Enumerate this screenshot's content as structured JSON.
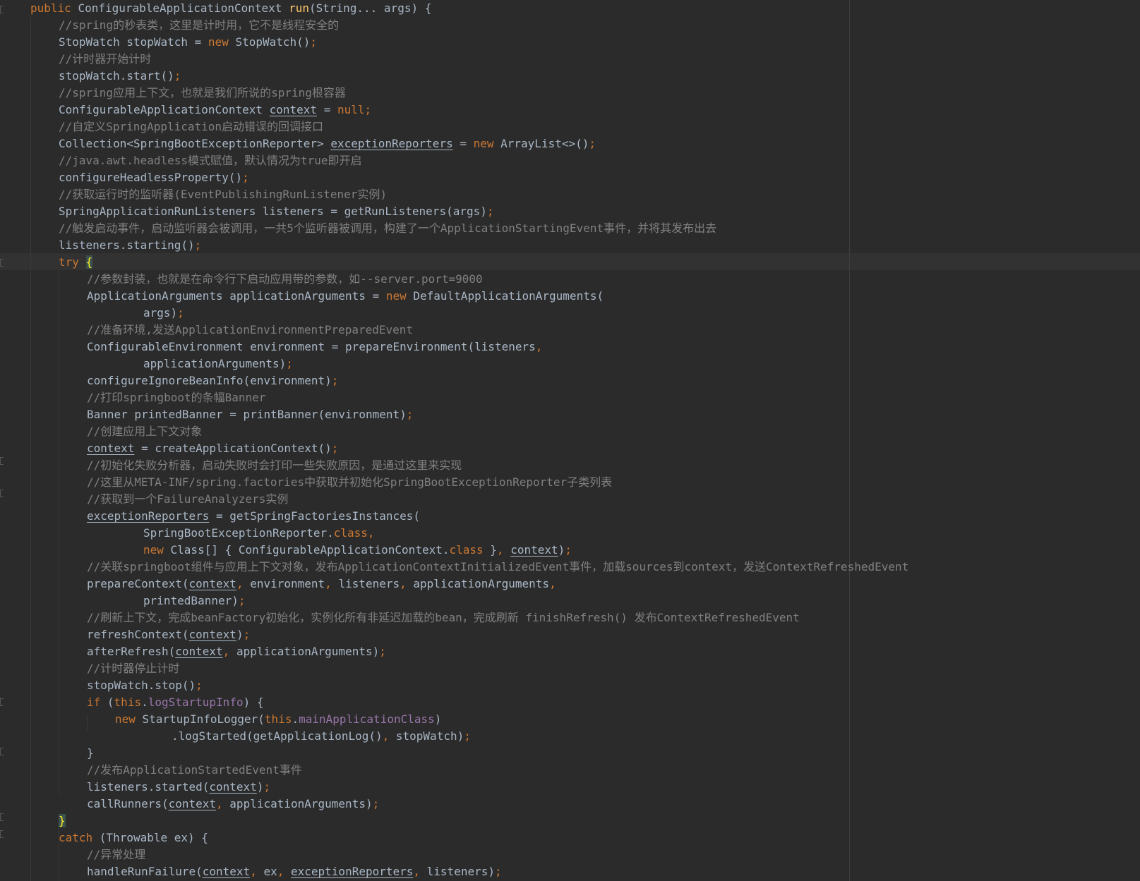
{
  "theme": {
    "background": "#2b2b2b",
    "default_text": "#a9b7c6",
    "keyword": "#cc7832",
    "comment": "#808080",
    "method_declaration": "#ffc66d",
    "field": "#9876aa",
    "brace_highlight": "#ffef28",
    "caret_row": "#323232"
  },
  "code": {
    "lines": [
      {
        "indent": 0,
        "tokens": [
          [
            "kw",
            "public "
          ],
          [
            "t",
            "ConfigurableApplicationContext "
          ],
          [
            "fn",
            "run"
          ],
          [
            "t",
            "(String... args) {"
          ]
        ]
      },
      {
        "indent": 1,
        "tokens": [
          [
            "cm",
            "//spring的秒表类，这里是计时用，它不是线程安全的"
          ]
        ]
      },
      {
        "indent": 1,
        "tokens": [
          [
            "t",
            "StopWatch stopWatch = "
          ],
          [
            "kw",
            "new "
          ],
          [
            "t",
            "StopWatch()"
          ],
          [
            "kw",
            ";"
          ]
        ]
      },
      {
        "indent": 1,
        "tokens": [
          [
            "cm",
            "//计时器开始计时"
          ]
        ]
      },
      {
        "indent": 1,
        "tokens": [
          [
            "t",
            "stopWatch.start()"
          ],
          [
            "kw",
            ";"
          ]
        ]
      },
      {
        "indent": 1,
        "tokens": [
          [
            "cm",
            "//spring应用上下文，也就是我们所说的spring根容器"
          ]
        ]
      },
      {
        "indent": 1,
        "tokens": [
          [
            "t",
            "ConfigurableApplicationContext "
          ],
          [
            "u",
            "context"
          ],
          [
            "t",
            " = "
          ],
          [
            "kw",
            "null;"
          ]
        ]
      },
      {
        "indent": 1,
        "tokens": [
          [
            "cm",
            "//自定义SpringApplication启动错误的回调接口"
          ]
        ]
      },
      {
        "indent": 1,
        "tokens": [
          [
            "t",
            "Collection<SpringBootExceptionReporter> "
          ],
          [
            "u",
            "exceptionReporters"
          ],
          [
            "t",
            " = "
          ],
          [
            "kw",
            "new "
          ],
          [
            "t",
            "ArrayList<>()"
          ],
          [
            "kw",
            ";"
          ]
        ]
      },
      {
        "indent": 1,
        "tokens": [
          [
            "cm",
            "//java.awt.headless模式赋值，默认情况为true即开启"
          ]
        ]
      },
      {
        "indent": 1,
        "tokens": [
          [
            "t",
            "configureHeadlessProperty()"
          ],
          [
            "kw",
            ";"
          ]
        ]
      },
      {
        "indent": 1,
        "tokens": [
          [
            "cm",
            "//获取运行时的监听器(EventPublishingRunListener实例)"
          ]
        ]
      },
      {
        "indent": 1,
        "tokens": [
          [
            "t",
            "SpringApplicationRunListeners listeners = getRunListeners(args)"
          ],
          [
            "kw",
            ";"
          ]
        ]
      },
      {
        "indent": 1,
        "tokens": [
          [
            "cm",
            "//触发启动事件，启动监听器会被调用，一共5个监听器被调用，构建了一个ApplicationStartingEvent事件，并将其发布出去"
          ]
        ]
      },
      {
        "indent": 1,
        "tokens": [
          [
            "t",
            "listeners.starting()"
          ],
          [
            "kw",
            ";"
          ]
        ]
      },
      {
        "indent": 1,
        "tokens": [
          [
            "kw",
            "try "
          ],
          [
            "bo",
            "{"
          ]
        ]
      },
      {
        "indent": 2,
        "tokens": [
          [
            "cm",
            "//参数封装，也就是在命令行下启动应用带的参数，如--server.port=9000"
          ]
        ]
      },
      {
        "indent": 2,
        "tokens": [
          [
            "t",
            "ApplicationArguments applicationArguments = "
          ],
          [
            "kw",
            "new "
          ],
          [
            "t",
            "DefaultApplicationArguments("
          ]
        ]
      },
      {
        "indent": 4,
        "tokens": [
          [
            "t",
            "args)"
          ],
          [
            "kw",
            ";"
          ]
        ]
      },
      {
        "indent": 2,
        "tokens": [
          [
            "cm",
            "//准备环境,发送ApplicationEnvironmentPreparedEvent"
          ]
        ]
      },
      {
        "indent": 2,
        "tokens": [
          [
            "t",
            "ConfigurableEnvironment environment = prepareEnvironment(listeners"
          ],
          [
            "kw",
            ","
          ]
        ]
      },
      {
        "indent": 4,
        "tokens": [
          [
            "t",
            "applicationArguments)"
          ],
          [
            "kw",
            ";"
          ]
        ]
      },
      {
        "indent": 2,
        "tokens": [
          [
            "t",
            "configureIgnoreBeanInfo(environment)"
          ],
          [
            "kw",
            ";"
          ]
        ]
      },
      {
        "indent": 2,
        "tokens": [
          [
            "cm",
            "//打印springboot的条幅Banner"
          ]
        ]
      },
      {
        "indent": 2,
        "tokens": [
          [
            "t",
            "Banner printedBanner = printBanner(environment)"
          ],
          [
            "kw",
            ";"
          ]
        ]
      },
      {
        "indent": 2,
        "tokens": [
          [
            "cm",
            "//创建应用上下文对象"
          ]
        ]
      },
      {
        "indent": 2,
        "tokens": [
          [
            "u",
            "context"
          ],
          [
            "t",
            " = createApplicationContext()"
          ],
          [
            "kw",
            ";"
          ]
        ]
      },
      {
        "indent": 2,
        "tokens": [
          [
            "cm",
            "//初始化失败分析器，启动失败时会打印一些失败原因，是通过这里来实现"
          ]
        ]
      },
      {
        "indent": 2,
        "tokens": [
          [
            "cm",
            "//这里从META-INF/spring.factories中获取并初始化SpringBootExceptionReporter子类列表"
          ]
        ]
      },
      {
        "indent": 2,
        "tokens": [
          [
            "cm",
            "//获取到一个FailureAnalyzers实例"
          ]
        ]
      },
      {
        "indent": 2,
        "tokens": [
          [
            "u",
            "exceptionReporters"
          ],
          [
            "t",
            " = getSpringFactoriesInstances("
          ]
        ]
      },
      {
        "indent": 4,
        "tokens": [
          [
            "t",
            "SpringBootExceptionReporter."
          ],
          [
            "kw",
            "class,"
          ]
        ]
      },
      {
        "indent": 4,
        "tokens": [
          [
            "kw",
            "new "
          ],
          [
            "t",
            "Class[] { ConfigurableApplicationContext."
          ],
          [
            "kw",
            "class "
          ],
          [
            "t",
            "}"
          ],
          [
            "kw",
            ", "
          ],
          [
            "u",
            "context"
          ],
          [
            "t",
            ")"
          ],
          [
            "kw",
            ";"
          ]
        ]
      },
      {
        "indent": 2,
        "tokens": [
          [
            "cm",
            "//关联springboot组件与应用上下文对象，发布ApplicationContextInitializedEvent事件，加载sources到context，发送ContextRefreshedEvent"
          ]
        ]
      },
      {
        "indent": 2,
        "tokens": [
          [
            "t",
            "prepareContext("
          ],
          [
            "u",
            "context"
          ],
          [
            "kw",
            ", "
          ],
          [
            "t",
            "environment"
          ],
          [
            "kw",
            ", "
          ],
          [
            "t",
            "listeners"
          ],
          [
            "kw",
            ", "
          ],
          [
            "t",
            "applicationArguments"
          ],
          [
            "kw",
            ","
          ]
        ]
      },
      {
        "indent": 4,
        "tokens": [
          [
            "t",
            "printedBanner)"
          ],
          [
            "kw",
            ";"
          ]
        ]
      },
      {
        "indent": 2,
        "tokens": [
          [
            "cm",
            "//刷新上下文，完成beanFactory初始化，实例化所有非延迟加载的bean，完成刷新 finishRefresh() 发布ContextRefreshedEvent"
          ]
        ]
      },
      {
        "indent": 2,
        "tokens": [
          [
            "t",
            "refreshContext("
          ],
          [
            "u",
            "context"
          ],
          [
            "t",
            ")"
          ],
          [
            "kw",
            ";"
          ]
        ]
      },
      {
        "indent": 2,
        "tokens": [
          [
            "t",
            "afterRefresh("
          ],
          [
            "u",
            "context"
          ],
          [
            "kw",
            ", "
          ],
          [
            "t",
            "applicationArguments)"
          ],
          [
            "kw",
            ";"
          ]
        ]
      },
      {
        "indent": 2,
        "tokens": [
          [
            "cm",
            "//计时器停止计时"
          ]
        ]
      },
      {
        "indent": 2,
        "tokens": [
          [
            "t",
            "stopWatch.stop()"
          ],
          [
            "kw",
            ";"
          ]
        ]
      },
      {
        "indent": 2,
        "tokens": [
          [
            "kw",
            "if "
          ],
          [
            "t",
            "("
          ],
          [
            "kw",
            "this"
          ],
          [
            "t",
            "."
          ],
          [
            "fld",
            "logStartupInfo"
          ],
          [
            "t",
            ") {"
          ]
        ]
      },
      {
        "indent": 3,
        "tokens": [
          [
            "kw",
            "new "
          ],
          [
            "t",
            "StartupInfoLogger("
          ],
          [
            "kw",
            "this"
          ],
          [
            "t",
            "."
          ],
          [
            "fld",
            "mainApplicationClass"
          ],
          [
            "t",
            ")"
          ]
        ]
      },
      {
        "indent": 5,
        "tokens": [
          [
            "t",
            ".logStarted(getApplicationLog()"
          ],
          [
            "kw",
            ", "
          ],
          [
            "t",
            "stopWatch)"
          ],
          [
            "kw",
            ";"
          ]
        ]
      },
      {
        "indent": 2,
        "tokens": [
          [
            "t",
            "}"
          ]
        ]
      },
      {
        "indent": 2,
        "tokens": [
          [
            "cm",
            "//发布ApplicationStartedEvent事件"
          ]
        ]
      },
      {
        "indent": 2,
        "tokens": [
          [
            "t",
            "listeners.started("
          ],
          [
            "u",
            "context"
          ],
          [
            "t",
            ")"
          ],
          [
            "kw",
            ";"
          ]
        ]
      },
      {
        "indent": 2,
        "tokens": [
          [
            "t",
            "callRunners("
          ],
          [
            "u",
            "context"
          ],
          [
            "kw",
            ", "
          ],
          [
            "t",
            "applicationArguments)"
          ],
          [
            "kw",
            ";"
          ]
        ]
      },
      {
        "indent": 1,
        "tokens": [
          [
            "bc",
            "}"
          ]
        ]
      },
      {
        "indent": 1,
        "tokens": [
          [
            "kw",
            "catch "
          ],
          [
            "t",
            "(Throwable ex) {"
          ]
        ]
      },
      {
        "indent": 2,
        "tokens": [
          [
            "cm",
            "//异常处理"
          ]
        ]
      },
      {
        "indent": 2,
        "tokens": [
          [
            "t",
            "handleRunFailure("
          ],
          [
            "u",
            "context"
          ],
          [
            "kw",
            ", "
          ],
          [
            "t",
            "ex"
          ],
          [
            "kw",
            ", "
          ],
          [
            "u",
            "exceptionReporters"
          ],
          [
            "kw",
            ", "
          ],
          [
            "t",
            "listeners)"
          ],
          [
            "kw",
            ";"
          ]
        ]
      }
    ]
  }
}
